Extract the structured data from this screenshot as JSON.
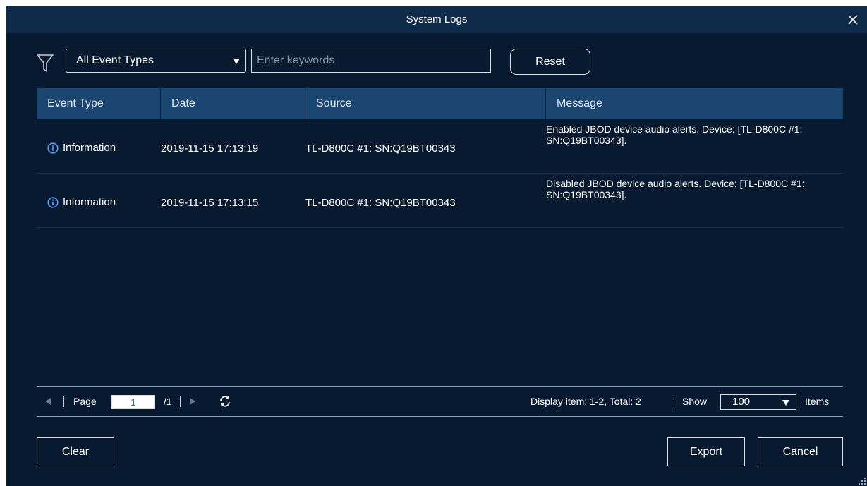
{
  "dialog": {
    "title": "System Logs"
  },
  "filter": {
    "event_type_selected": "All Event Types",
    "search_placeholder": "Enter keywords",
    "reset_label": "Reset"
  },
  "table": {
    "headers": [
      "Event Type",
      "Date",
      "Source",
      "Message"
    ],
    "rows": [
      {
        "type": "Information",
        "date": "2019-11-15 17:13:19",
        "source": "TL-D800C #1: SN:Q19BT00343",
        "message": "Enabled JBOD device audio alerts. Device: [TL-D800C #1: SN:Q19BT00343]."
      },
      {
        "type": "Information",
        "date": "2019-11-15 17:13:15",
        "source": "TL-D800C #1: SN:Q19BT00343",
        "message": "Disabled JBOD device audio alerts. Device: [TL-D800C #1: SN:Q19BT00343]."
      }
    ]
  },
  "pager": {
    "page_label": "Page",
    "page_value": "1",
    "total_pages": "/1",
    "display_text": "Display item: 1-2, Total: 2",
    "show_label": "Show",
    "show_value": "100",
    "items_label": "Items"
  },
  "footer": {
    "clear_label": "Clear",
    "export_label": "Export",
    "cancel_label": "Cancel"
  },
  "colors": {
    "background": "#071a30",
    "titlebar": "#0e2b49",
    "table_header": "#1b4671",
    "info_icon": "#4aa3ff"
  },
  "icons": [
    "close-icon",
    "filter-icon",
    "info-icon",
    "prev-page-icon",
    "next-page-icon",
    "refresh-icon",
    "resize-grip-icon"
  ]
}
